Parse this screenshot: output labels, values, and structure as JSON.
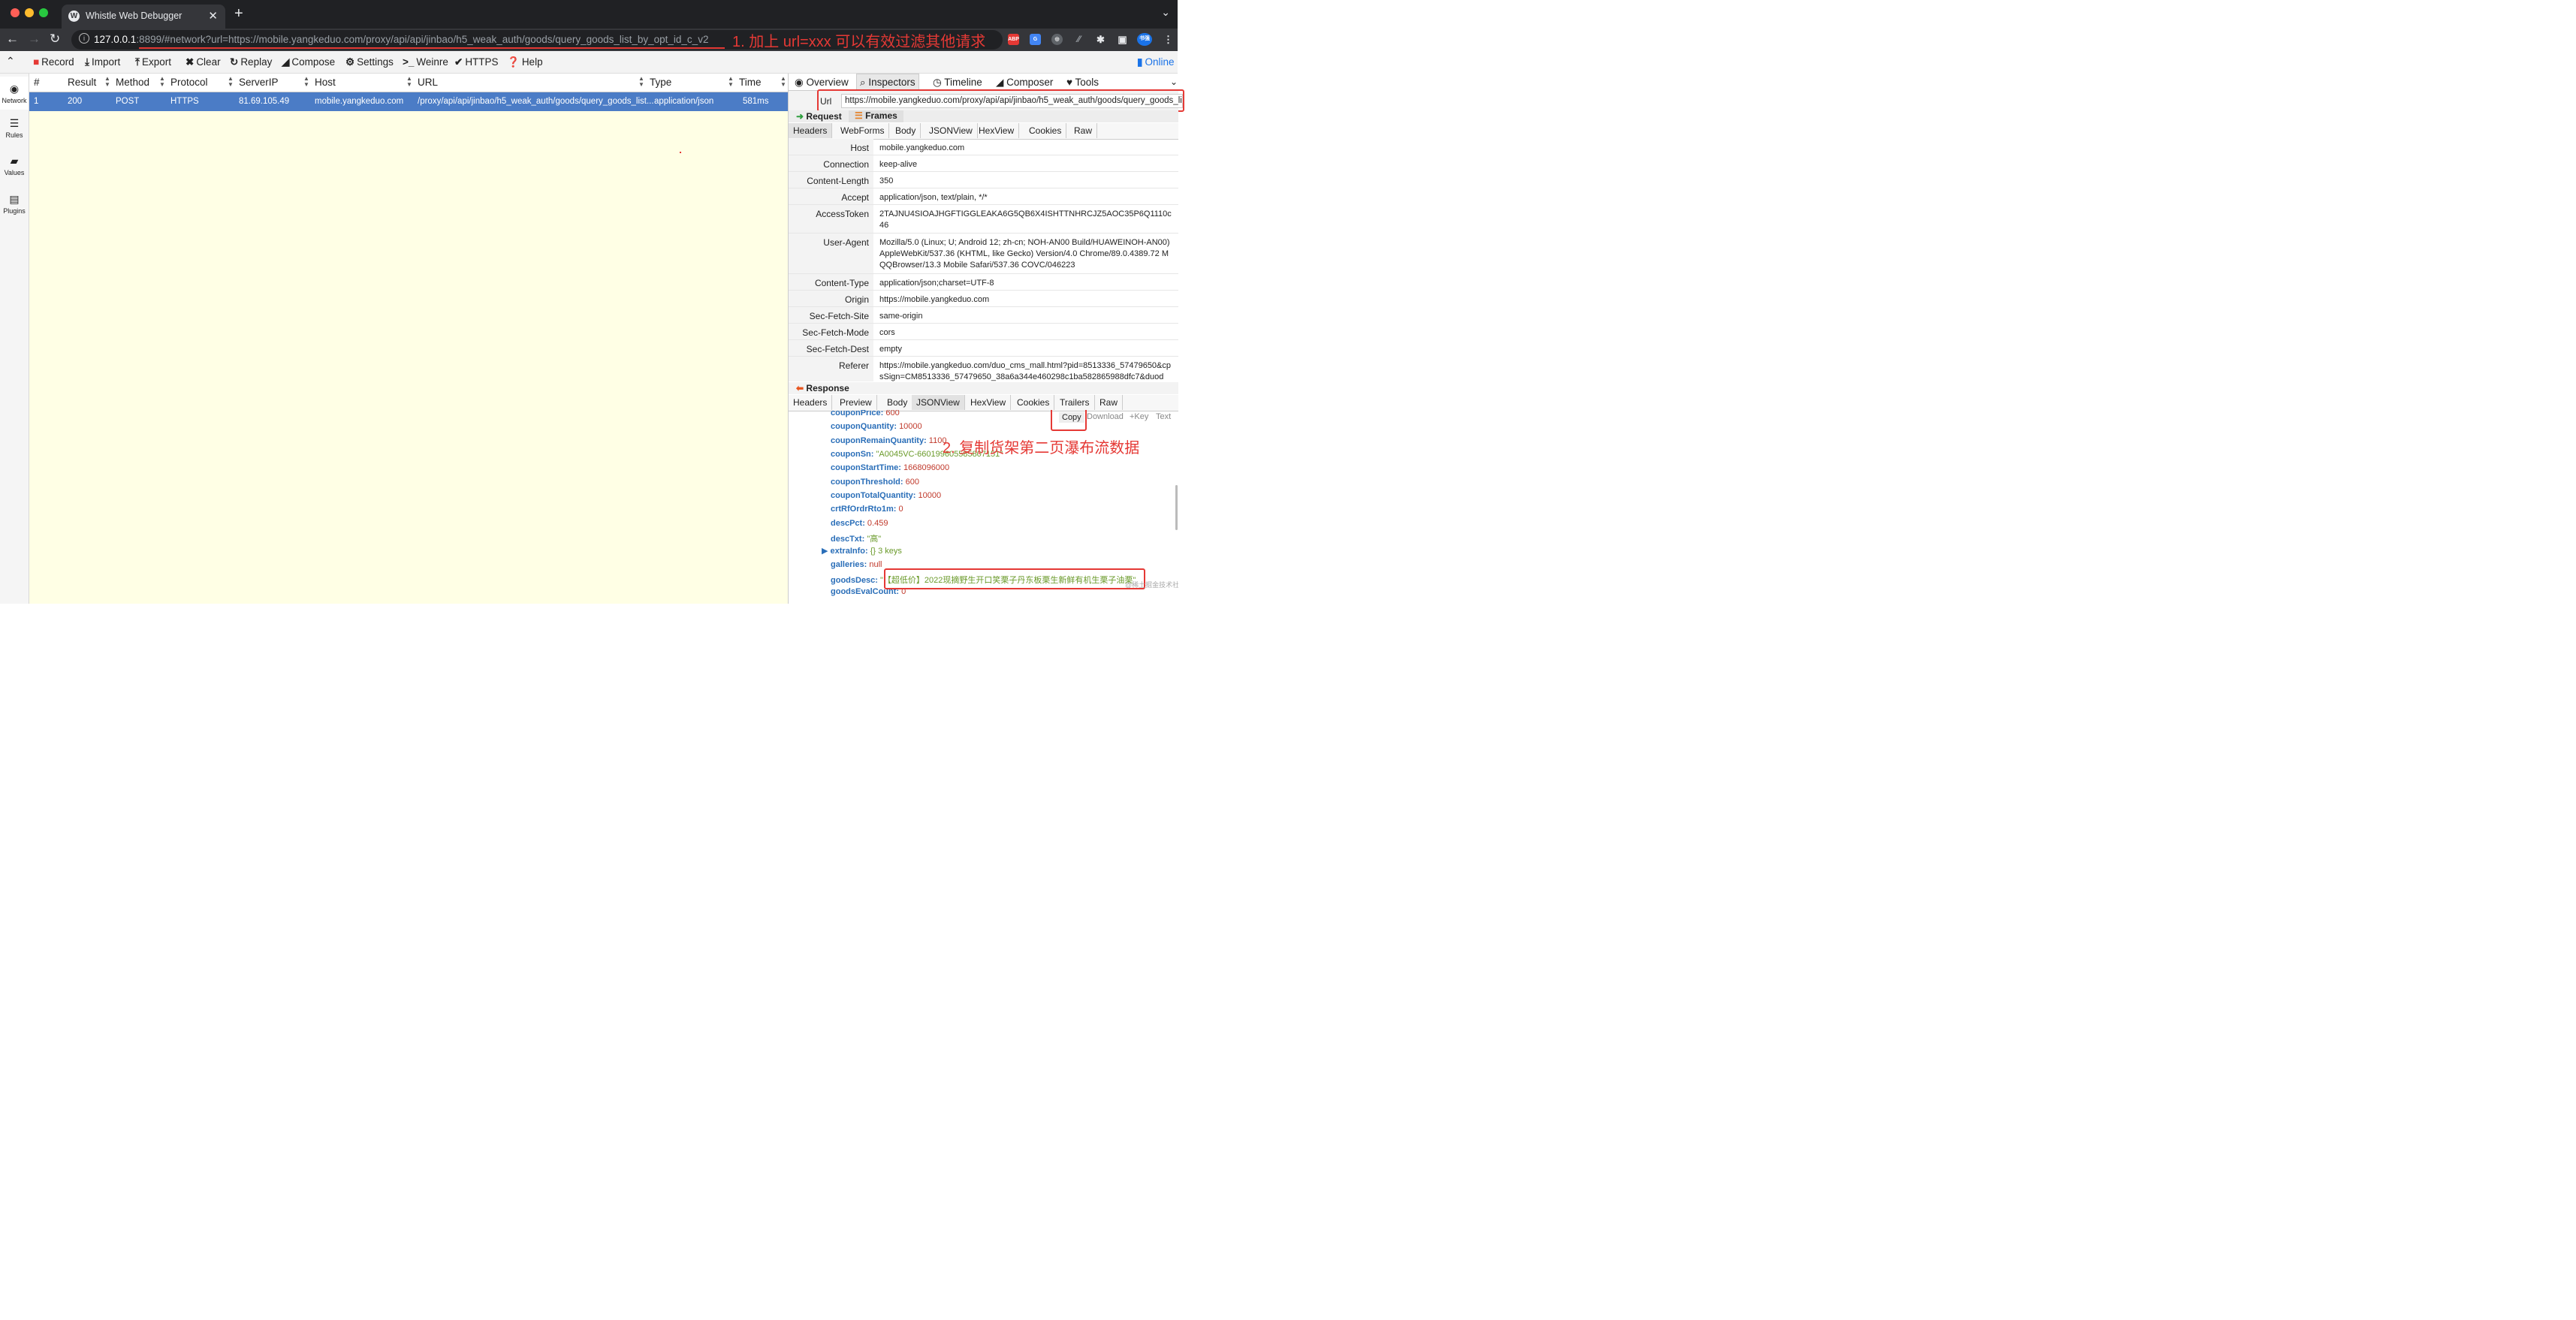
{
  "browser": {
    "tab_title": "Whistle Web Debugger",
    "url_host": "127.0.0.1",
    "url_rest": ":8899/#network?url=https://mobile.yangkeduo.com/proxy/api/api/jinbao/h5_weak_auth/goods/query_goods_list_by_opt_id_c_v2",
    "ext_abp": "ABP",
    "ext_profile": "书强"
  },
  "annotations": {
    "note1": "1. 加上 url=xxx 可以有效过滤其他请求",
    "note2": "2. 复制货架第二页瀑布流数据"
  },
  "toolbar": {
    "items": [
      "Record",
      "Import",
      "Export",
      "Clear",
      "Replay",
      "Compose",
      "Settings",
      "Weinre",
      "HTTPS",
      "Help"
    ],
    "online": "Online"
  },
  "leftnav": [
    "Network",
    "Rules",
    "Values",
    "Plugins"
  ],
  "list": {
    "headers": [
      "#",
      "Result",
      "Method",
      "Protocol",
      "ServerIP",
      "Host",
      "URL",
      "Type",
      "Time"
    ],
    "rows": [
      {
        "num": "1",
        "result": "200",
        "method": "POST",
        "protocol": "HTTPS",
        "serverip": "81.69.105.49",
        "host": "mobile.yangkeduo.com",
        "url": "/proxy/api/api/jinbao/h5_weak_auth/goods/query_goods_list...",
        "type": "application/json",
        "time": "581ms"
      }
    ]
  },
  "inspector": {
    "tabs": [
      "Overview",
      "Inspectors",
      "Timeline",
      "Composer",
      "Tools"
    ],
    "url_label": "Url",
    "url_value": "https://mobile.yangkeduo.com/proxy/api/api/jinbao/h5_weak_auth/goods/query_goods_list",
    "request_label": "Request",
    "frames_label": "Frames",
    "request_tabs": [
      "Headers",
      "WebForms",
      "Body",
      "JSONView",
      "HexView",
      "Cookies",
      "Raw"
    ],
    "headers": [
      {
        "k": "Host",
        "v": "mobile.yangkeduo.com"
      },
      {
        "k": "Connection",
        "v": "keep-alive"
      },
      {
        "k": "Content-Length",
        "v": "350"
      },
      {
        "k": "Accept",
        "v": "application/json, text/plain, */*"
      },
      {
        "k": "AccessToken",
        "v": "2TAJNU4SIOAJHGFTIGGLEAKA6G5QB6X4ISHTTNHRCJZ5AOC35P6Q1110c46"
      },
      {
        "k": "User-Agent",
        "v": "Mozilla/5.0 (Linux; U; Android 12; zh-cn; NOH-AN00 Build/HUAWEINOH-AN00) AppleWebKit/537.36 (KHTML, like Gecko) Version/4.0 Chrome/89.0.4389.72 MQQBrowser/13.3 Mobile Safari/537.36 COVC/046223"
      },
      {
        "k": "Content-Type",
        "v": "application/json;charset=UTF-8"
      },
      {
        "k": "Origin",
        "v": "https://mobile.yangkeduo.com"
      },
      {
        "k": "Sec-Fetch-Site",
        "v": "same-origin"
      },
      {
        "k": "Sec-Fetch-Mode",
        "v": "cors"
      },
      {
        "k": "Sec-Fetch-Dest",
        "v": "empty"
      },
      {
        "k": "Referer",
        "v": "https://mobile.yangkeduo.com/duo_cms_mall.html?pid=8513336_57479650&cpsSign=CM8513336_57479650_38a6a344e460298c1ba582865988dfc7&duod"
      }
    ],
    "response_label": "Response",
    "response_tabs": [
      "Headers",
      "Preview",
      "Body",
      "JSONView",
      "HexView",
      "Cookies",
      "Trailers",
      "Raw"
    ],
    "json_buttons": [
      "Copy",
      "Download",
      "+Key",
      "Text"
    ],
    "json_lines": [
      {
        "k": "couponPrice:",
        "v": "600",
        "t": "n"
      },
      {
        "k": "couponQuantity:",
        "v": "10000",
        "t": "n"
      },
      {
        "k": "couponRemainQuantity:",
        "v": "1100",
        "t": "n"
      },
      {
        "k": "couponSn:",
        "v": "\"A0045VC-660199605585807151\"",
        "t": "s"
      },
      {
        "k": "couponStartTime:",
        "v": "1668096000",
        "t": "n"
      },
      {
        "k": "couponThreshold:",
        "v": "600",
        "t": "n"
      },
      {
        "k": "couponTotalQuantity:",
        "v": "10000",
        "t": "n"
      },
      {
        "k": "crtRfOrdrRto1m:",
        "v": "0",
        "t": "n"
      },
      {
        "k": "descPct:",
        "v": "0.459",
        "t": "n"
      },
      {
        "k": "descTxt:",
        "v": "\"高\"",
        "t": "s"
      },
      {
        "k": "extraInfo:",
        "v": "{}  3 keys",
        "t": "s"
      },
      {
        "k": "galleries:",
        "v": "null",
        "t": "n"
      },
      {
        "k": "goodsDesc:",
        "v": "\"【超低价】2022现摘野生开口笑栗子丹东板栗生新鲜有机生栗子油栗\"",
        "t": "s"
      },
      {
        "k": "goodsEvalCount:",
        "v": "0",
        "t": "n"
      }
    ],
    "watermark": "@稀土掘金技术社区"
  },
  "colors": {
    "accent": "#4b7cc6",
    "annotation": "#e53935",
    "list_bg": "#ffffe5"
  }
}
